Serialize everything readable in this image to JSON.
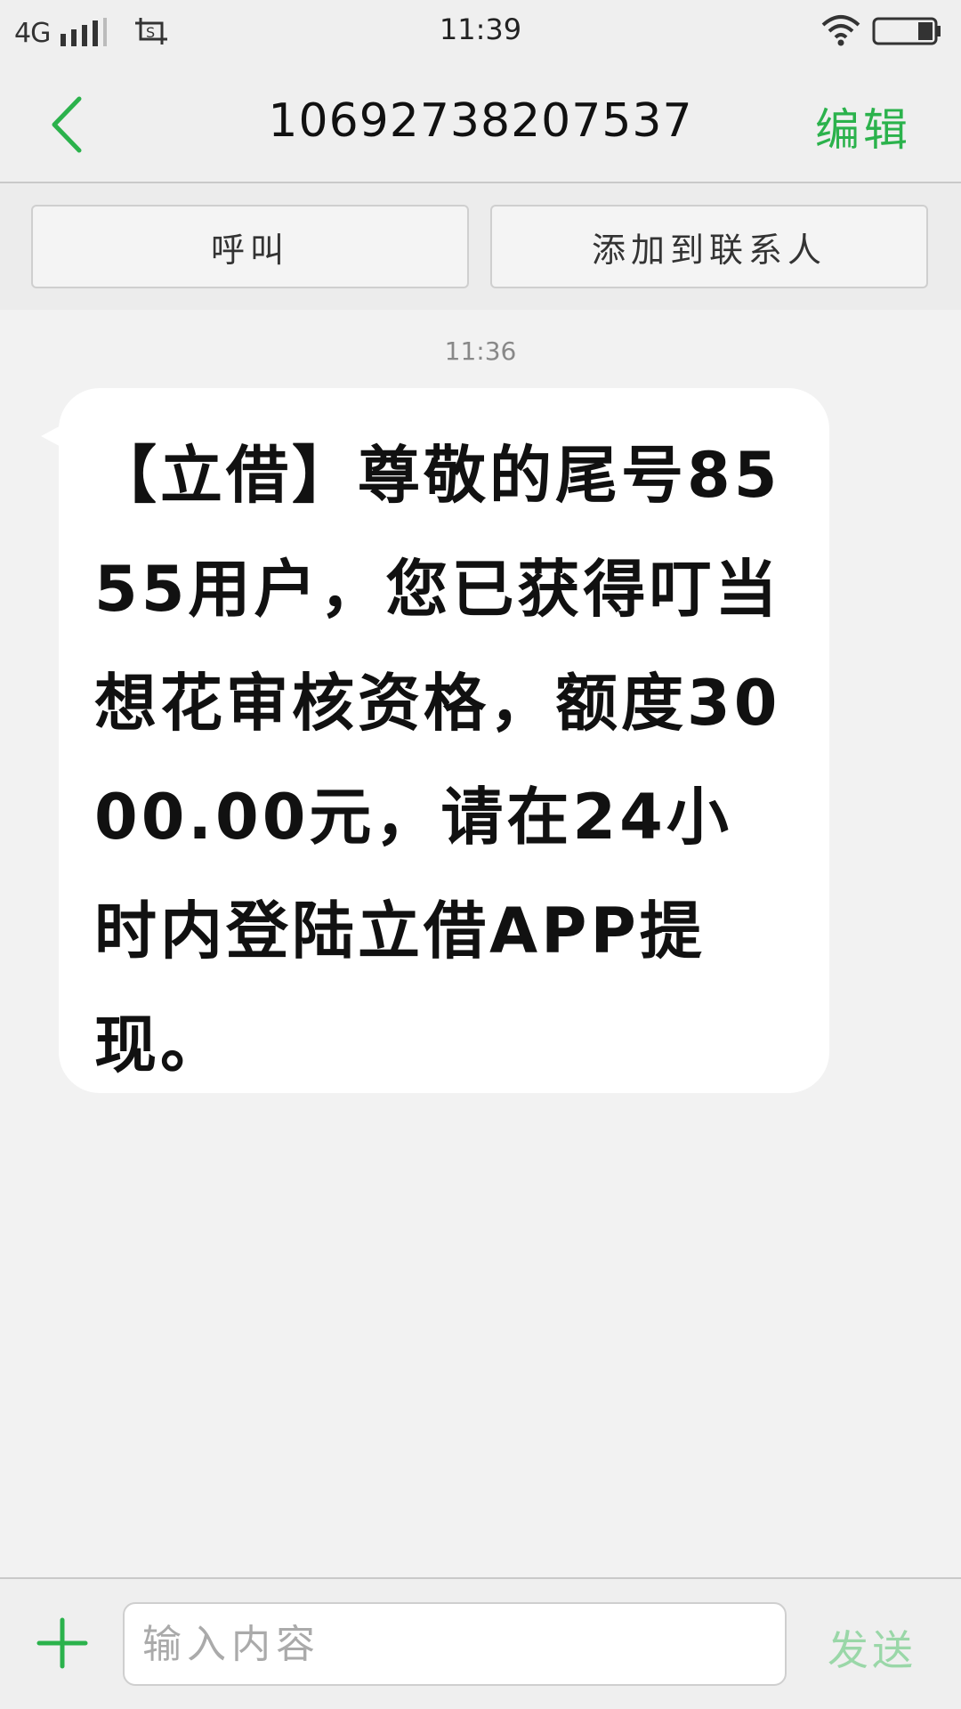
{
  "status_bar": {
    "network": "4G",
    "time": "11:39",
    "icons": [
      "signal-icon",
      "screenshot-icon",
      "wifi-icon",
      "battery-icon"
    ]
  },
  "header": {
    "title": "10692738207537",
    "edit_label": "编辑",
    "back_icon": "chevron-left-icon"
  },
  "actions": {
    "call_label": "呼叫",
    "add_contact_label": "添加到联系人"
  },
  "conversation": {
    "messages": [
      {
        "time": "11:36",
        "text": "【立借】尊敬的尾号8555用户，您已获得叮当想花审核资格，额度3000.00元，请在24小时内登陆立借APP提现。"
      }
    ]
  },
  "input_bar": {
    "placeholder": "输入内容",
    "send_label": "发送",
    "add_icon": "plus-icon"
  },
  "colors": {
    "accent": "#2bb24c",
    "accent_disabled": "#9ad7a8",
    "background": "#f2f2f2",
    "bubble": "#ffffff"
  }
}
